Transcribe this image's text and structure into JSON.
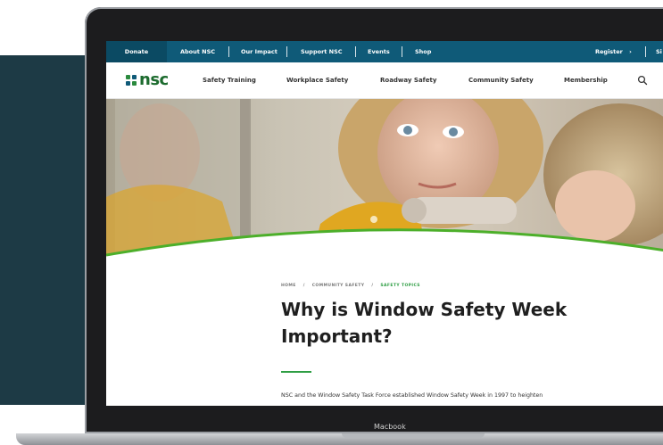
{
  "utility_bar": {
    "items": [
      {
        "label": "Donate"
      },
      {
        "label": "About NSC"
      },
      {
        "label": "Our Impact"
      },
      {
        "label": "Support NSC"
      },
      {
        "label": "Events"
      },
      {
        "label": "Shop"
      }
    ],
    "register": "Register",
    "register_chevron": "›",
    "sign_in_partial": "Si"
  },
  "nav": {
    "logo_text": "nsc",
    "items": [
      {
        "label": "Safety Training"
      },
      {
        "label": "Workplace Safety"
      },
      {
        "label": "Roadway Safety"
      },
      {
        "label": "Community Safety"
      },
      {
        "label": "Membership"
      }
    ]
  },
  "breadcrumb": {
    "home": "HOME",
    "sep1": "/",
    "section": "COMMUNITY SAFETY",
    "sep2": "/",
    "current": "SAFETY TOPICS"
  },
  "article": {
    "title": "Why is Window Safety Week Important?",
    "intro": "NSC and the Window Safety Task Force established Window Safety Week in 1997 to heighten"
  },
  "device": {
    "label": "Macbook"
  },
  "colors": {
    "utility_bar": "#0f5a78",
    "accent_green": "#2f9e44",
    "logo_green": "#1c6b2e",
    "background_panel": "#1d3a45"
  },
  "icons": {
    "search": "search-icon"
  }
}
